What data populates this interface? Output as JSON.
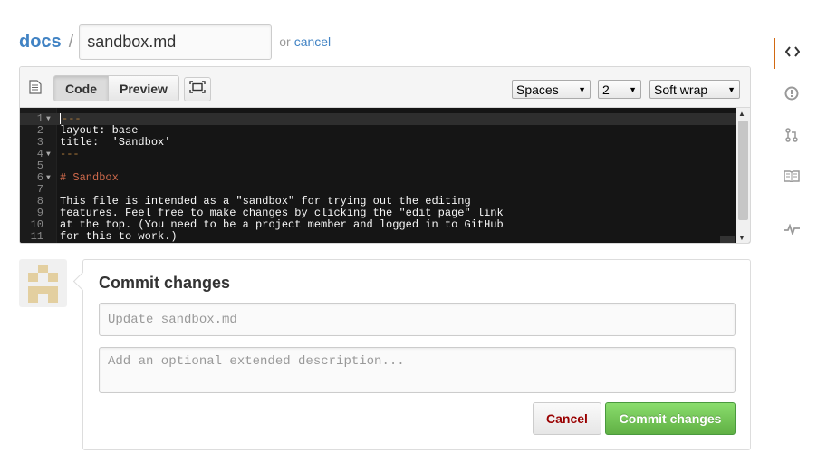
{
  "breadcrumb": {
    "repo": "docs",
    "separator": "/",
    "filename": "sandbox.md",
    "or_text": "or",
    "cancel_link": "cancel"
  },
  "editor": {
    "tabs": [
      "Code",
      "Preview"
    ],
    "active_tab": "Code",
    "indent_mode": "Spaces",
    "indent_size": "2",
    "wrap_mode": "Soft wrap",
    "lines": [
      {
        "n": "1",
        "text": "---",
        "fold": true,
        "style": "dash",
        "active": true
      },
      {
        "n": "2",
        "text": "layout: base",
        "fold": false,
        "style": "plain",
        "active": false
      },
      {
        "n": "3",
        "text": "title:  'Sandbox'",
        "fold": false,
        "style": "plain",
        "active": false
      },
      {
        "n": "4",
        "text": "---",
        "fold": true,
        "style": "dash",
        "active": false
      },
      {
        "n": "5",
        "text": "",
        "fold": false,
        "style": "plain",
        "active": false
      },
      {
        "n": "6",
        "text": "# Sandbox",
        "fold": true,
        "style": "heading",
        "active": false
      },
      {
        "n": "7",
        "text": "",
        "fold": false,
        "style": "plain",
        "active": false
      },
      {
        "n": "8",
        "text": "This file is intended as a \"sandbox\" for trying out the editing",
        "fold": false,
        "style": "plain",
        "active": false
      },
      {
        "n": "9",
        "text": "features. Feel free to make changes by clicking the \"edit page\" link",
        "fold": false,
        "style": "plain",
        "active": false
      },
      {
        "n": "10",
        "text": "at the top. (You need to be a project member and logged in to GitHub",
        "fold": false,
        "style": "plain",
        "active": false
      },
      {
        "n": "11",
        "text": "for this to work.)",
        "fold": false,
        "style": "plain",
        "active": false
      }
    ]
  },
  "commit": {
    "title": "Commit changes",
    "summary_placeholder": "Update sandbox.md",
    "description_placeholder": "Add an optional extended description...",
    "cancel_label": "Cancel",
    "commit_label": "Commit changes"
  },
  "sidebar": {
    "items": [
      {
        "icon": "code-icon",
        "selected": true
      },
      {
        "icon": "issues-icon",
        "selected": false
      },
      {
        "icon": "pull-request-icon",
        "selected": false
      },
      {
        "icon": "wiki-icon",
        "selected": false
      },
      {
        "icon": "pulse-icon",
        "selected": false
      }
    ]
  },
  "colors": {
    "link": "#4183c4",
    "editor_bg": "#151515",
    "heading": "#cf6a4c",
    "commit_green": "#60b044",
    "cancel_red": "#990000",
    "selected_accent": "#d26911"
  }
}
